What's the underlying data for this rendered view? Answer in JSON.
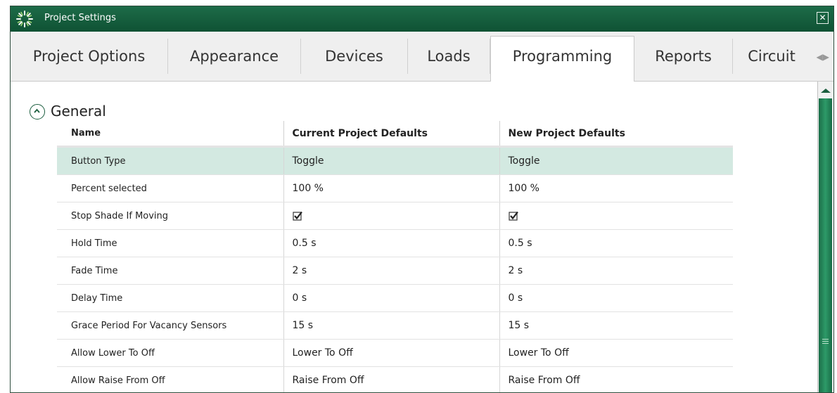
{
  "window": {
    "title": "Project Settings",
    "close_glyph": "✕"
  },
  "tabs": [
    {
      "label": "Project Options"
    },
    {
      "label": "Appearance"
    },
    {
      "label": "Devices"
    },
    {
      "label": "Loads"
    },
    {
      "label": "Programming",
      "active": true
    },
    {
      "label": "Reports"
    },
    {
      "label": "Circuit"
    }
  ],
  "tab_scroll_glyphs": "◀▶",
  "section": {
    "title": "General",
    "toggle_icon": "chevron-up-circle-icon"
  },
  "table": {
    "columns": [
      "Name",
      "Current Project Defaults",
      "New Project Defaults"
    ],
    "rows": [
      {
        "name": "Button Type",
        "current": "Toggle",
        "new": "Toggle",
        "selected": true
      },
      {
        "name": "Percent selected",
        "current": "100 %",
        "new": "100 %"
      },
      {
        "name": "Stop Shade If Moving",
        "current": "",
        "new": "",
        "current_checked": true,
        "new_checked": true
      },
      {
        "name": "Hold Time",
        "current": "0.5 s",
        "new": "0.5 s"
      },
      {
        "name": "Fade Time",
        "current": "2 s",
        "new": "2 s"
      },
      {
        "name": "Delay Time",
        "current": "0 s",
        "new": "0 s"
      },
      {
        "name": "Grace Period For Vacancy Sensors",
        "current": "15 s",
        "new": "15 s"
      },
      {
        "name": "Allow Lower To Off",
        "current": "Lower To Off",
        "new": "Lower To Off"
      },
      {
        "name": "Allow Raise From Off",
        "current": "Raise From Off",
        "new": "Raise From Off"
      }
    ]
  },
  "colors": {
    "title_bar": "#0f5234",
    "selected_row": "#d3e9e1",
    "scroll_thumb": "#1a6d48"
  }
}
